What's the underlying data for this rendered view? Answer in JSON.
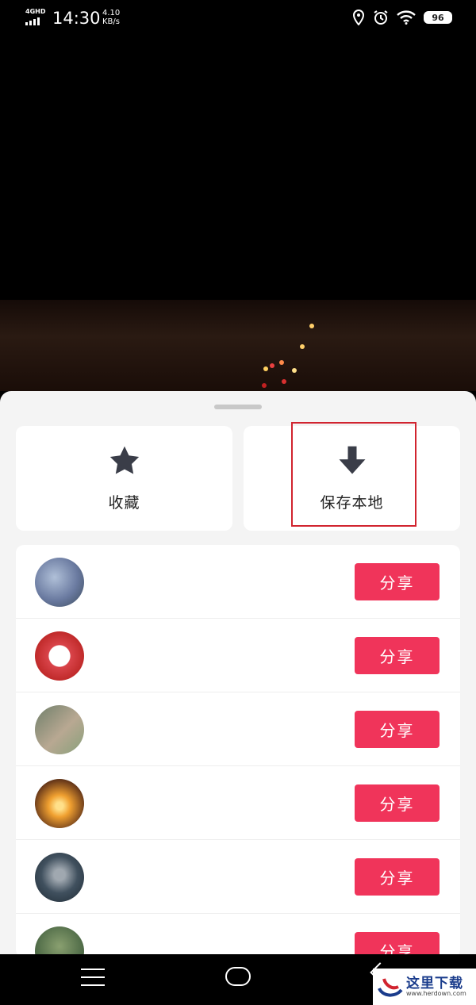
{
  "status_bar": {
    "network": "4GHD",
    "time": "14:30",
    "speed_value": "4.10",
    "speed_unit": "KB/s",
    "battery": "96"
  },
  "sheet": {
    "actions": [
      {
        "label": "收藏",
        "icon": "star-icon"
      },
      {
        "label": "保存本地",
        "icon": "download-arrow-icon"
      }
    ],
    "contacts": [
      {
        "name": "",
        "share_label": "分享",
        "avatar_color": "#7f8fb0"
      },
      {
        "name": "",
        "share_label": "分享",
        "avatar_color": "#d9444a"
      },
      {
        "name": "",
        "share_label": "分享",
        "avatar_color": "#8a9a7a"
      },
      {
        "name": "",
        "share_label": "分享",
        "avatar_color": "#d89030"
      },
      {
        "name": "",
        "share_label": "分享",
        "avatar_color": "#40505e"
      },
      {
        "name": "",
        "share_label": "分享",
        "avatar_color": "#506c48"
      }
    ]
  },
  "watermark": {
    "chinese": "这里下载",
    "latin": "www.herdown.com"
  },
  "colors": {
    "share_button": "#f0345a",
    "highlight_border": "#d1242f",
    "sheet_background": "#f4f4f4"
  }
}
